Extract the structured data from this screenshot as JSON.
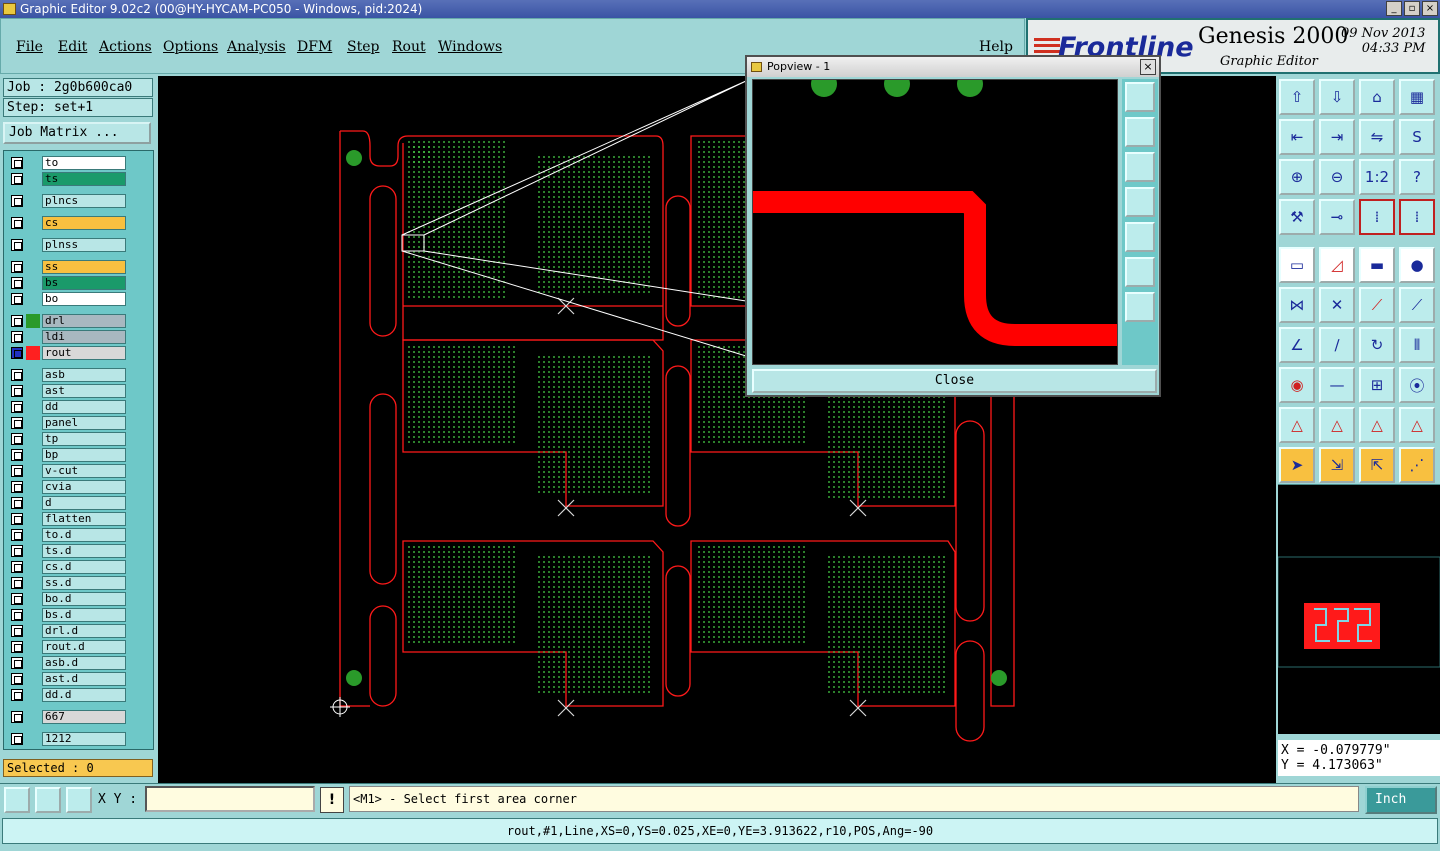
{
  "window": {
    "title": "Graphic Editor 9.02c2 (00@HY-HYCAM-PC050 - Windows, pid:2024)"
  },
  "menu": [
    "File",
    "Edit",
    "Actions",
    "Options",
    "Analysis",
    "DFM",
    "Step",
    "Rout",
    "Windows"
  ],
  "help_label": "Help",
  "brand": {
    "logo": "Frontline",
    "product": "Genesis 2000",
    "subtitle": "Graphic Editor",
    "date": "09 Nov 2013",
    "time": "04:33 PM"
  },
  "job": {
    "job_line": "Job : 2g0b600ca0",
    "step_line": "Step: set+1",
    "matrix_button": "Job Matrix ..."
  },
  "layers": [
    {
      "name": "to",
      "color": "#ffffff"
    },
    {
      "name": "ts",
      "color": "#1a9a6a"
    },
    {
      "name": "plncs",
      "color": "#b8e6e6"
    },
    {
      "name": "cs",
      "color": "#f8c040"
    },
    {
      "name": "plnss",
      "color": "#b8e6e6"
    },
    {
      "name": "ss",
      "color": "#f8c040"
    },
    {
      "name": "bs",
      "color": "#1a9a6a"
    },
    {
      "name": "bo",
      "color": "#ffffff"
    },
    {
      "name": "drl",
      "color": "#a8b8c0",
      "swatch": "#2a9a2a"
    },
    {
      "name": "ldi",
      "color": "#a8b8c0"
    },
    {
      "name": "rout",
      "color": "#d8d8d8",
      "swatch": "#ff2020",
      "active": true
    },
    {
      "name": "asb",
      "color": "#b8e6e6"
    },
    {
      "name": "ast",
      "color": "#b8e6e6"
    },
    {
      "name": "dd",
      "color": "#b8e6e6"
    },
    {
      "name": "panel",
      "color": "#b8e6e6"
    },
    {
      "name": "tp",
      "color": "#b8e6e6"
    },
    {
      "name": "bp",
      "color": "#b8e6e6"
    },
    {
      "name": "v-cut",
      "color": "#b8e6e6"
    },
    {
      "name": "cvia",
      "color": "#b8e6e6"
    },
    {
      "name": "d",
      "color": "#b8e6e6"
    },
    {
      "name": "flatten",
      "color": "#b8e6e6"
    },
    {
      "name": "to.d",
      "color": "#b8e6e6"
    },
    {
      "name": "ts.d",
      "color": "#b8e6e6"
    },
    {
      "name": "cs.d",
      "color": "#b8e6e6"
    },
    {
      "name": "ss.d",
      "color": "#b8e6e6"
    },
    {
      "name": "bo.d",
      "color": "#b8e6e6"
    },
    {
      "name": "bs.d",
      "color": "#b8e6e6"
    },
    {
      "name": "drl.d",
      "color": "#b8e6e6"
    },
    {
      "name": "rout.d",
      "color": "#b8e6e6"
    },
    {
      "name": "asb.d",
      "color": "#b8e6e6"
    },
    {
      "name": "ast.d",
      "color": "#b8e6e6"
    },
    {
      "name": "dd.d",
      "color": "#b8e6e6"
    },
    {
      "name": "667",
      "color": "#d8d8d8"
    },
    {
      "name": "1212",
      "color": "#b8e6e6"
    }
  ],
  "selected": "Selected : 0",
  "popview": {
    "title": "Popview - 1",
    "close_label": "Close"
  },
  "coords": {
    "x": "X = -0.079779\"",
    "y": "Y = 4.173063\""
  },
  "bottom": {
    "xy_label": "X Y :",
    "xy_value": "",
    "prompt": "<M1> - Select first area corner",
    "units": "Inch"
  },
  "status": "rout,#1,Line,XS=0,YS=0.025,XE=0,YE=3.913622,r10,POS,Ang=-90",
  "colors": {
    "rout": "#ff0000",
    "drill": "#2a9a2a",
    "pad": "#3aaa3a",
    "accent": "#9fd6d6"
  }
}
